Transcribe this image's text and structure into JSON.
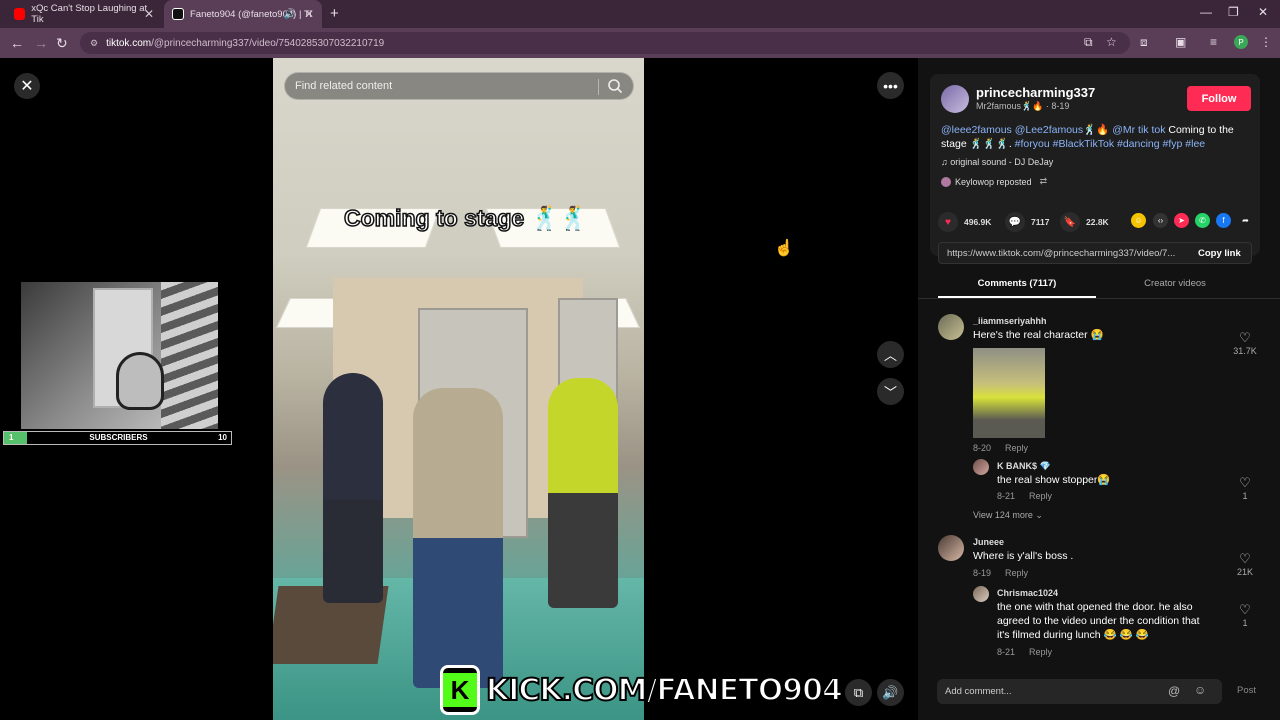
{
  "browser": {
    "tabs": [
      {
        "title": "xQc Can't Stop Laughing at Tik",
        "icon": "youtube-icon"
      },
      {
        "title": "Faneto904 (@faneto904) | Ti",
        "icon": "tiktok-icon"
      }
    ],
    "url_host": "tiktok.com",
    "url_path": "/@princecharming337/video/7540285307032210719"
  },
  "video": {
    "search_placeholder": "Find related content",
    "overlay_text": "Coming to stage 🕺🕺"
  },
  "stream_overlay": {
    "subs_left": "1",
    "subs_label": "SUBSCRIBERS",
    "subs_right": "10",
    "subs_progress": 0.1,
    "kick_letter": "K",
    "kick_text": "KICK.COM/FANETO904"
  },
  "post": {
    "author": "princecharming337",
    "author_sub": "Mr2famous🕺🔥 · 8-19",
    "follow_label": "Follow",
    "caption_tags_1": "@leee2famous @Lee2famous🕺🔥 @Mr tik tok",
    "caption_text": " Coming to the stage 🕺🕺🕺. ",
    "caption_tags_2": "#foryou #BlackTikTok #dancing #fyp #lee",
    "music": "♫  original sound - DJ DeJay",
    "repost": "Keylowop reposted",
    "likes": "496.9K",
    "comments_count": "7117",
    "saves": "22.8K",
    "link": "https://www.tiktok.com/@princecharming337/video/7...",
    "copy_label": "Copy link",
    "tab_comments": "Comments (7117)",
    "tab_creator": "Creator videos"
  },
  "comments": [
    {
      "user": "_iiammseriyahhh",
      "text": "Here's the real character 😭",
      "date": "8-20",
      "reply": "Reply",
      "likes": "31.7K"
    },
    {
      "user": "K BANK$ 💎",
      "text": "the real show stopper😭",
      "date": "8-21",
      "reply": "Reply",
      "likes": "1"
    },
    {
      "view_more": "View 124 more ⌄"
    },
    {
      "user": "Juneee",
      "text": "Where is y'all's boss .",
      "date": "8-19",
      "reply": "Reply",
      "likes": "21K"
    },
    {
      "user": "Chrismac1024",
      "text_lines": [
        "the one with that opened the door. he also",
        "agreed to the video under the condition that",
        "it's filmed during lunch 😂 😂 😂"
      ],
      "date": "8-21",
      "reply": "Reply",
      "likes": "1"
    }
  ],
  "composer": {
    "placeholder": "Add comment...",
    "post_label": "Post"
  },
  "colors": {
    "accent": "#fe2c55",
    "kick_green": "#53fc18",
    "tab_bar": "#3a2539",
    "link_blue": "#8ab4f8"
  }
}
